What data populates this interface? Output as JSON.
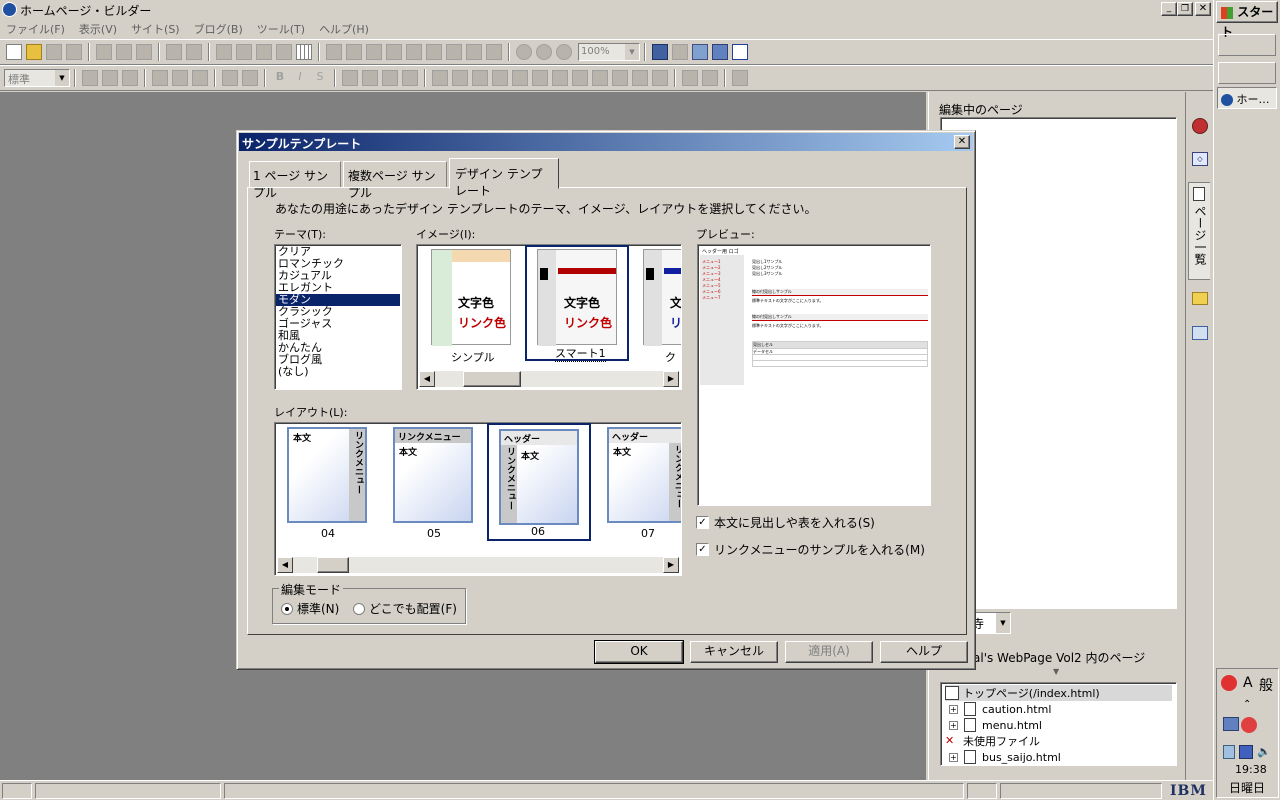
{
  "app": {
    "title": "ホームページ・ビルダー",
    "menu": [
      "ファイル(F)",
      "表示(V)",
      "サイト(S)",
      "ブログ(B)",
      "ツール(T)",
      "ヘルプ(H)"
    ],
    "zoom": "100%",
    "style_select": "標準"
  },
  "taskbar": {
    "start": "スタート",
    "task": "ホー…",
    "ime_a": "A",
    "ime_mode": "般",
    "time": "19:38",
    "day": "日曜日"
  },
  "right_panel": {
    "editing_pages_label": "編集中のページ",
    "side_tab_label": "ページ一覧",
    "site_title": "al's WebPage Vol2 内のページ",
    "select_fragment": "寺",
    "tree": [
      {
        "label": "トップページ(/index.html)",
        "level": 0
      },
      {
        "label": "caution.html",
        "level": 1
      },
      {
        "label": "menu.html",
        "level": 1
      },
      {
        "label": "未使用ファイル",
        "level": 0
      },
      {
        "label": "bus_saijo.html",
        "level": 1
      }
    ]
  },
  "status_bar": {
    "ibm": "IBM"
  },
  "dialog": {
    "title": "サンプルテンプレート",
    "tabs": [
      "1 ページ サンプル",
      "複数ページ サンプル",
      "デザイン テンプレート"
    ],
    "active_tab": 2,
    "instruction": "あなたの用途にあったデザイン テンプレートのテーマ、イメージ、レイアウトを選択してください。",
    "theme_label": "テーマ(T):",
    "themes": [
      "クリア",
      "ロマンチック",
      "カジュアル",
      "エレガント",
      "モダン",
      "クラシック",
      "ゴージャス",
      "和風",
      "かんたん",
      "ブログ風",
      "(なし)"
    ],
    "selected_theme": 4,
    "image_label": "イメージ(I):",
    "images": [
      {
        "name": "シンプル",
        "text1": "文字色",
        "text2": "リンク色"
      },
      {
        "name": "スマート1",
        "text1": "文字色",
        "text2": "リンク色"
      },
      {
        "name": "ク",
        "text1": "文",
        "text2": "リ"
      }
    ],
    "preview_label": "プレビュー:",
    "preview": {
      "header_text": "ヘッダー用 ロゴ",
      "menu_items": [
        "メニュー1",
        "メニュー2",
        "メニュー3",
        "メニュー4",
        "メニュー5",
        "メニュー6",
        "メニュー7"
      ],
      "lines": [
        "見出し1サンプル",
        "見出し2サンプル",
        "見出し3サンプル"
      ],
      "section1": "線の付見出しサンプル",
      "section2": "線の付見出しサンプル",
      "body1": "標準テキストの文字がここに入ります。",
      "body2": "標準テキストの文字がここに入ります。",
      "table_title": "見出しセル",
      "table_cell": "データセル"
    },
    "layout_label": "レイアウト(L):",
    "layouts": [
      {
        "num": "04",
        "a": "本文",
        "b": "リンクメニュー"
      },
      {
        "num": "05",
        "a": "リンクメニュー",
        "b": "本文"
      },
      {
        "num": "06",
        "a": "ヘッダー",
        "b": "リンクメニュー",
        "c": "本文"
      },
      {
        "num": "07",
        "a": "ヘッダー",
        "b": "本文",
        "c": "リンクメニュー"
      }
    ],
    "checkbox1": "本文に見出しや表を入れる(S)",
    "checkbox2": "リンクメニューのサンプルを入れる(M)",
    "edit_mode_label": "編集モード",
    "radio1": "標準(N)",
    "radio2": "どこでも配置(F)",
    "buttons": {
      "ok": "OK",
      "cancel": "キャンセル",
      "apply": "適用(A)",
      "help": "ヘルプ"
    }
  }
}
